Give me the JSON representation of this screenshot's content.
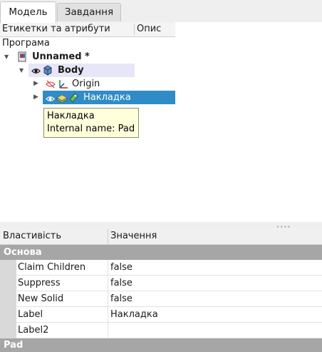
{
  "tabs": [
    {
      "label": "Модель",
      "active": true
    },
    {
      "label": "Завдання",
      "active": false
    }
  ],
  "tree": {
    "columns": [
      "Етикетки та атрибути",
      "Опис"
    ],
    "root_label": "Програма",
    "items": [
      {
        "label": "Unnamed *",
        "icon": "document-icon",
        "expanded": true
      },
      {
        "label": "Body",
        "icon": "body-icon",
        "expanded": true
      },
      {
        "label": "Origin",
        "icon": "origin-axes-icon",
        "expanded": false,
        "hidden": true
      },
      {
        "label": "Накладка",
        "icon": "pad-icon",
        "expanded": false,
        "selected": true
      }
    ]
  },
  "tooltip": {
    "line1": "Накладка",
    "line2": "Internal name: Pad"
  },
  "property_view": {
    "columns": [
      "Властивість",
      "Значення"
    ],
    "groups": [
      {
        "name": "Основа",
        "rows": [
          {
            "name": "Claim Children",
            "value": "false"
          },
          {
            "name": "Suppress",
            "value": "false"
          },
          {
            "name": "New Solid",
            "value": "false"
          },
          {
            "name": "Label",
            "value": "Накладка"
          },
          {
            "name": "Label2",
            "value": ""
          }
        ]
      },
      {
        "name": "Pad",
        "rows": []
      }
    ]
  },
  "colors": {
    "selection": "#308cc6",
    "group_header": "#a6a6a6",
    "tooltip_bg": "#ffffdc"
  }
}
